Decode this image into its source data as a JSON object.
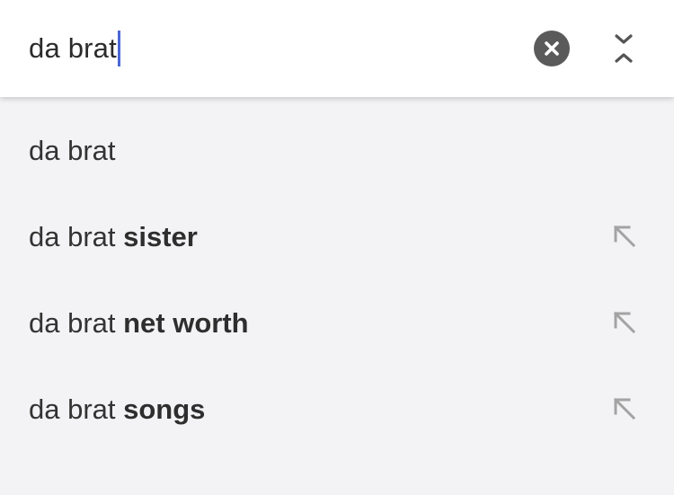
{
  "search": {
    "query": "da brat"
  },
  "icons": {
    "clear": "close-circle-icon",
    "collapse": "collapse-icon",
    "fill": "arrow-up-left-icon"
  },
  "colors": {
    "caret": "#4a67d6",
    "clear_button": "#5a5a5a",
    "background": "#f3f3f5",
    "search_bar": "#ffffff"
  },
  "suggestions": [
    {
      "base": "da brat",
      "completion": "",
      "has_fill_icon": false
    },
    {
      "base": "da brat ",
      "completion": "sister",
      "has_fill_icon": true
    },
    {
      "base": "da brat ",
      "completion": "net worth",
      "has_fill_icon": true
    },
    {
      "base": "da brat ",
      "completion": "songs",
      "has_fill_icon": true
    }
  ]
}
